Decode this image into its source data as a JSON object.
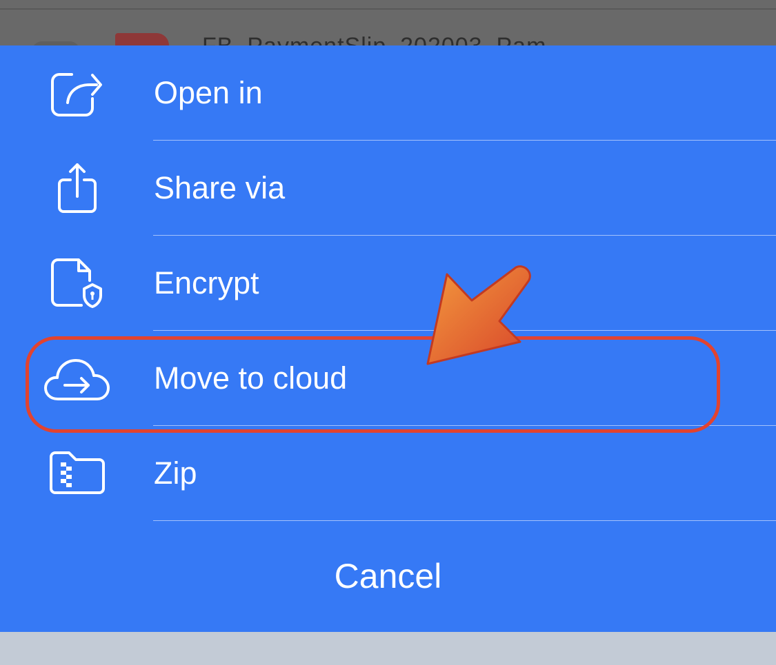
{
  "background": {
    "file_name": "FB_PaymentSlip_202003_Pam"
  },
  "action_sheet": {
    "accent_color": "#3679f5",
    "items": [
      {
        "label": "Open in",
        "icon": "open-in-icon"
      },
      {
        "label": "Share via",
        "icon": "share-icon"
      },
      {
        "label": "Encrypt",
        "icon": "encrypt-file-icon"
      },
      {
        "label": "Move to cloud",
        "icon": "cloud-upload-icon",
        "highlighted": true
      },
      {
        "label": "Zip",
        "icon": "zip-folder-icon"
      }
    ],
    "cancel_label": "Cancel"
  },
  "annotation": {
    "highlight_color": "#e2432f",
    "pointer": "arrow-pointer-icon"
  }
}
